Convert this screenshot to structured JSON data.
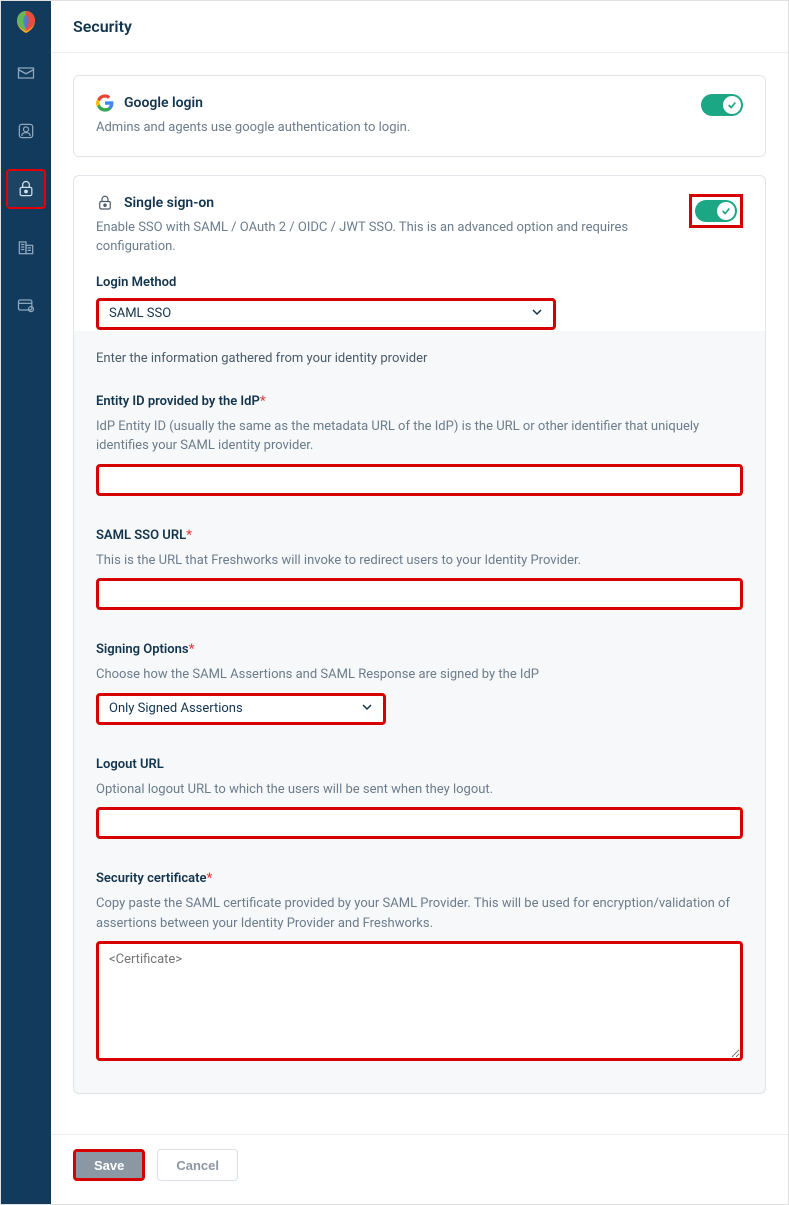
{
  "header": {
    "title": "Security"
  },
  "cards": {
    "google": {
      "title": "Google login",
      "desc": "Admins and agents use google authentication to login."
    },
    "sso": {
      "title": "Single sign-on",
      "desc": "Enable SSO with SAML / OAuth 2 / OIDC / JWT SSO. This is an advanced option and requires configuration.",
      "login_method_label": "Login Method",
      "login_method_value": "SAML SSO"
    }
  },
  "form": {
    "intro": "Enter the information gathered from your identity provider",
    "entity_id": {
      "label": "Entity ID provided by the IdP",
      "help": "IdP Entity ID (usually the same as the metadata URL of the IdP) is the URL or other identifier that uniquely identifies your SAML identity provider.",
      "value": ""
    },
    "sso_url": {
      "label": "SAML SSO URL",
      "help": "This is the URL that Freshworks will invoke to redirect users to your Identity Provider.",
      "value": ""
    },
    "signing": {
      "label": "Signing Options",
      "help": "Choose how the SAML Assertions and SAML Response are signed by the IdP",
      "value": "Only Signed Assertions"
    },
    "logout": {
      "label": "Logout URL",
      "help": "Optional logout URL to which the users will be sent when they logout.",
      "value": ""
    },
    "cert": {
      "label": "Security certificate",
      "help": "Copy paste the SAML certificate provided by your SAML Provider. This will be used for encryption/validation of assertions between your Identity Provider and Freshworks.",
      "placeholder": "<Certificate>"
    }
  },
  "footer": {
    "save": "Save",
    "cancel": "Cancel"
  }
}
